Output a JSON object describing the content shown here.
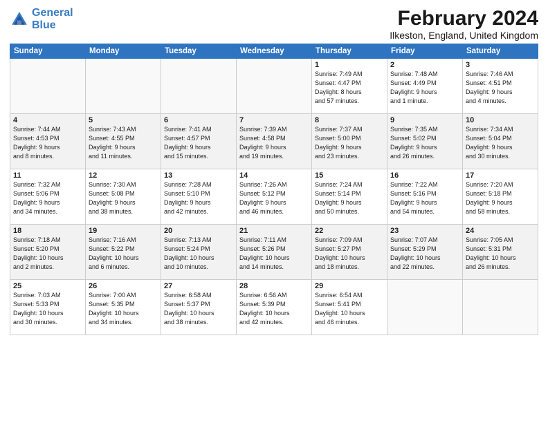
{
  "header": {
    "logo_line1": "General",
    "logo_line2": "Blue",
    "month": "February 2024",
    "location": "Ilkeston, England, United Kingdom"
  },
  "weekdays": [
    "Sunday",
    "Monday",
    "Tuesday",
    "Wednesday",
    "Thursday",
    "Friday",
    "Saturday"
  ],
  "weeks": [
    [
      {
        "day": "",
        "info": ""
      },
      {
        "day": "",
        "info": ""
      },
      {
        "day": "",
        "info": ""
      },
      {
        "day": "",
        "info": ""
      },
      {
        "day": "1",
        "info": "Sunrise: 7:49 AM\nSunset: 4:47 PM\nDaylight: 8 hours\nand 57 minutes."
      },
      {
        "day": "2",
        "info": "Sunrise: 7:48 AM\nSunset: 4:49 PM\nDaylight: 9 hours\nand 1 minute."
      },
      {
        "day": "3",
        "info": "Sunrise: 7:46 AM\nSunset: 4:51 PM\nDaylight: 9 hours\nand 4 minutes."
      }
    ],
    [
      {
        "day": "4",
        "info": "Sunrise: 7:44 AM\nSunset: 4:53 PM\nDaylight: 9 hours\nand 8 minutes."
      },
      {
        "day": "5",
        "info": "Sunrise: 7:43 AM\nSunset: 4:55 PM\nDaylight: 9 hours\nand 11 minutes."
      },
      {
        "day": "6",
        "info": "Sunrise: 7:41 AM\nSunset: 4:57 PM\nDaylight: 9 hours\nand 15 minutes."
      },
      {
        "day": "7",
        "info": "Sunrise: 7:39 AM\nSunset: 4:58 PM\nDaylight: 9 hours\nand 19 minutes."
      },
      {
        "day": "8",
        "info": "Sunrise: 7:37 AM\nSunset: 5:00 PM\nDaylight: 9 hours\nand 23 minutes."
      },
      {
        "day": "9",
        "info": "Sunrise: 7:35 AM\nSunset: 5:02 PM\nDaylight: 9 hours\nand 26 minutes."
      },
      {
        "day": "10",
        "info": "Sunrise: 7:34 AM\nSunset: 5:04 PM\nDaylight: 9 hours\nand 30 minutes."
      }
    ],
    [
      {
        "day": "11",
        "info": "Sunrise: 7:32 AM\nSunset: 5:06 PM\nDaylight: 9 hours\nand 34 minutes."
      },
      {
        "day": "12",
        "info": "Sunrise: 7:30 AM\nSunset: 5:08 PM\nDaylight: 9 hours\nand 38 minutes."
      },
      {
        "day": "13",
        "info": "Sunrise: 7:28 AM\nSunset: 5:10 PM\nDaylight: 9 hours\nand 42 minutes."
      },
      {
        "day": "14",
        "info": "Sunrise: 7:26 AM\nSunset: 5:12 PM\nDaylight: 9 hours\nand 46 minutes."
      },
      {
        "day": "15",
        "info": "Sunrise: 7:24 AM\nSunset: 5:14 PM\nDaylight: 9 hours\nand 50 minutes."
      },
      {
        "day": "16",
        "info": "Sunrise: 7:22 AM\nSunset: 5:16 PM\nDaylight: 9 hours\nand 54 minutes."
      },
      {
        "day": "17",
        "info": "Sunrise: 7:20 AM\nSunset: 5:18 PM\nDaylight: 9 hours\nand 58 minutes."
      }
    ],
    [
      {
        "day": "18",
        "info": "Sunrise: 7:18 AM\nSunset: 5:20 PM\nDaylight: 10 hours\nand 2 minutes."
      },
      {
        "day": "19",
        "info": "Sunrise: 7:16 AM\nSunset: 5:22 PM\nDaylight: 10 hours\nand 6 minutes."
      },
      {
        "day": "20",
        "info": "Sunrise: 7:13 AM\nSunset: 5:24 PM\nDaylight: 10 hours\nand 10 minutes."
      },
      {
        "day": "21",
        "info": "Sunrise: 7:11 AM\nSunset: 5:26 PM\nDaylight: 10 hours\nand 14 minutes."
      },
      {
        "day": "22",
        "info": "Sunrise: 7:09 AM\nSunset: 5:27 PM\nDaylight: 10 hours\nand 18 minutes."
      },
      {
        "day": "23",
        "info": "Sunrise: 7:07 AM\nSunset: 5:29 PM\nDaylight: 10 hours\nand 22 minutes."
      },
      {
        "day": "24",
        "info": "Sunrise: 7:05 AM\nSunset: 5:31 PM\nDaylight: 10 hours\nand 26 minutes."
      }
    ],
    [
      {
        "day": "25",
        "info": "Sunrise: 7:03 AM\nSunset: 5:33 PM\nDaylight: 10 hours\nand 30 minutes."
      },
      {
        "day": "26",
        "info": "Sunrise: 7:00 AM\nSunset: 5:35 PM\nDaylight: 10 hours\nand 34 minutes."
      },
      {
        "day": "27",
        "info": "Sunrise: 6:58 AM\nSunset: 5:37 PM\nDaylight: 10 hours\nand 38 minutes."
      },
      {
        "day": "28",
        "info": "Sunrise: 6:56 AM\nSunset: 5:39 PM\nDaylight: 10 hours\nand 42 minutes."
      },
      {
        "day": "29",
        "info": "Sunrise: 6:54 AM\nSunset: 5:41 PM\nDaylight: 10 hours\nand 46 minutes."
      },
      {
        "day": "",
        "info": ""
      },
      {
        "day": "",
        "info": ""
      }
    ]
  ]
}
